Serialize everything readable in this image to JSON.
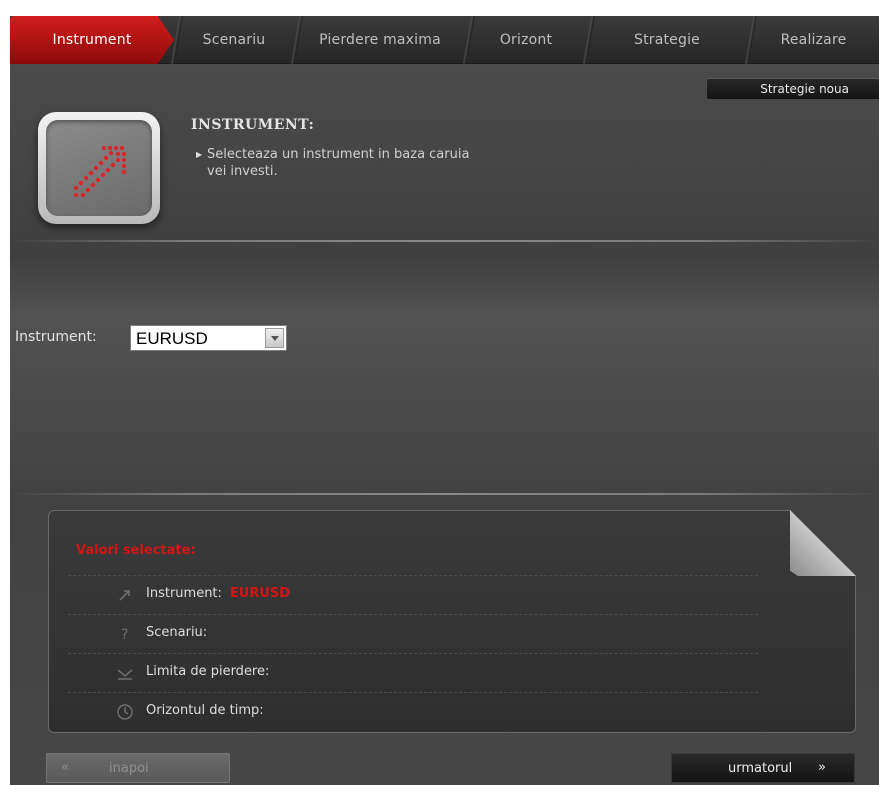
{
  "tabs": [
    {
      "label": "Instrument",
      "active": true
    },
    {
      "label": "Scenariu",
      "active": false
    },
    {
      "label": "Pierdere maxima",
      "active": false
    },
    {
      "label": "Orizont",
      "active": false
    },
    {
      "label": "Strategie",
      "active": false
    },
    {
      "label": "Realizare",
      "active": false
    }
  ],
  "new_strategy_label": "Strategie noua",
  "info": {
    "title": "INSTRUMENT:",
    "description_line1": "Selecteaza un instrument in baza caruia",
    "description_line2": "vei investi.",
    "icon": "diagonal-arrow-icon"
  },
  "instrument_field": {
    "label": "Instrument:",
    "value": "EURUSD"
  },
  "summary": {
    "title": "Valori selectate:",
    "rows": [
      {
        "label": "Instrument:",
        "value": "EURUSD",
        "icon": "arrow-icon"
      },
      {
        "label": "Scenariu:",
        "value": "",
        "icon": "question-icon"
      },
      {
        "label": "Limita de pierdere:",
        "value": "",
        "icon": "down-arrow-icon"
      },
      {
        "label": "Orizontul de timp:",
        "value": "",
        "icon": "clock-icon"
      }
    ]
  },
  "nav": {
    "prev_label": "inapoi",
    "prev_arrow": "«",
    "next_label": "urmatorul",
    "next_arrow": "»"
  },
  "colors": {
    "accent_red": "#d21d1d",
    "background": "#464646"
  }
}
